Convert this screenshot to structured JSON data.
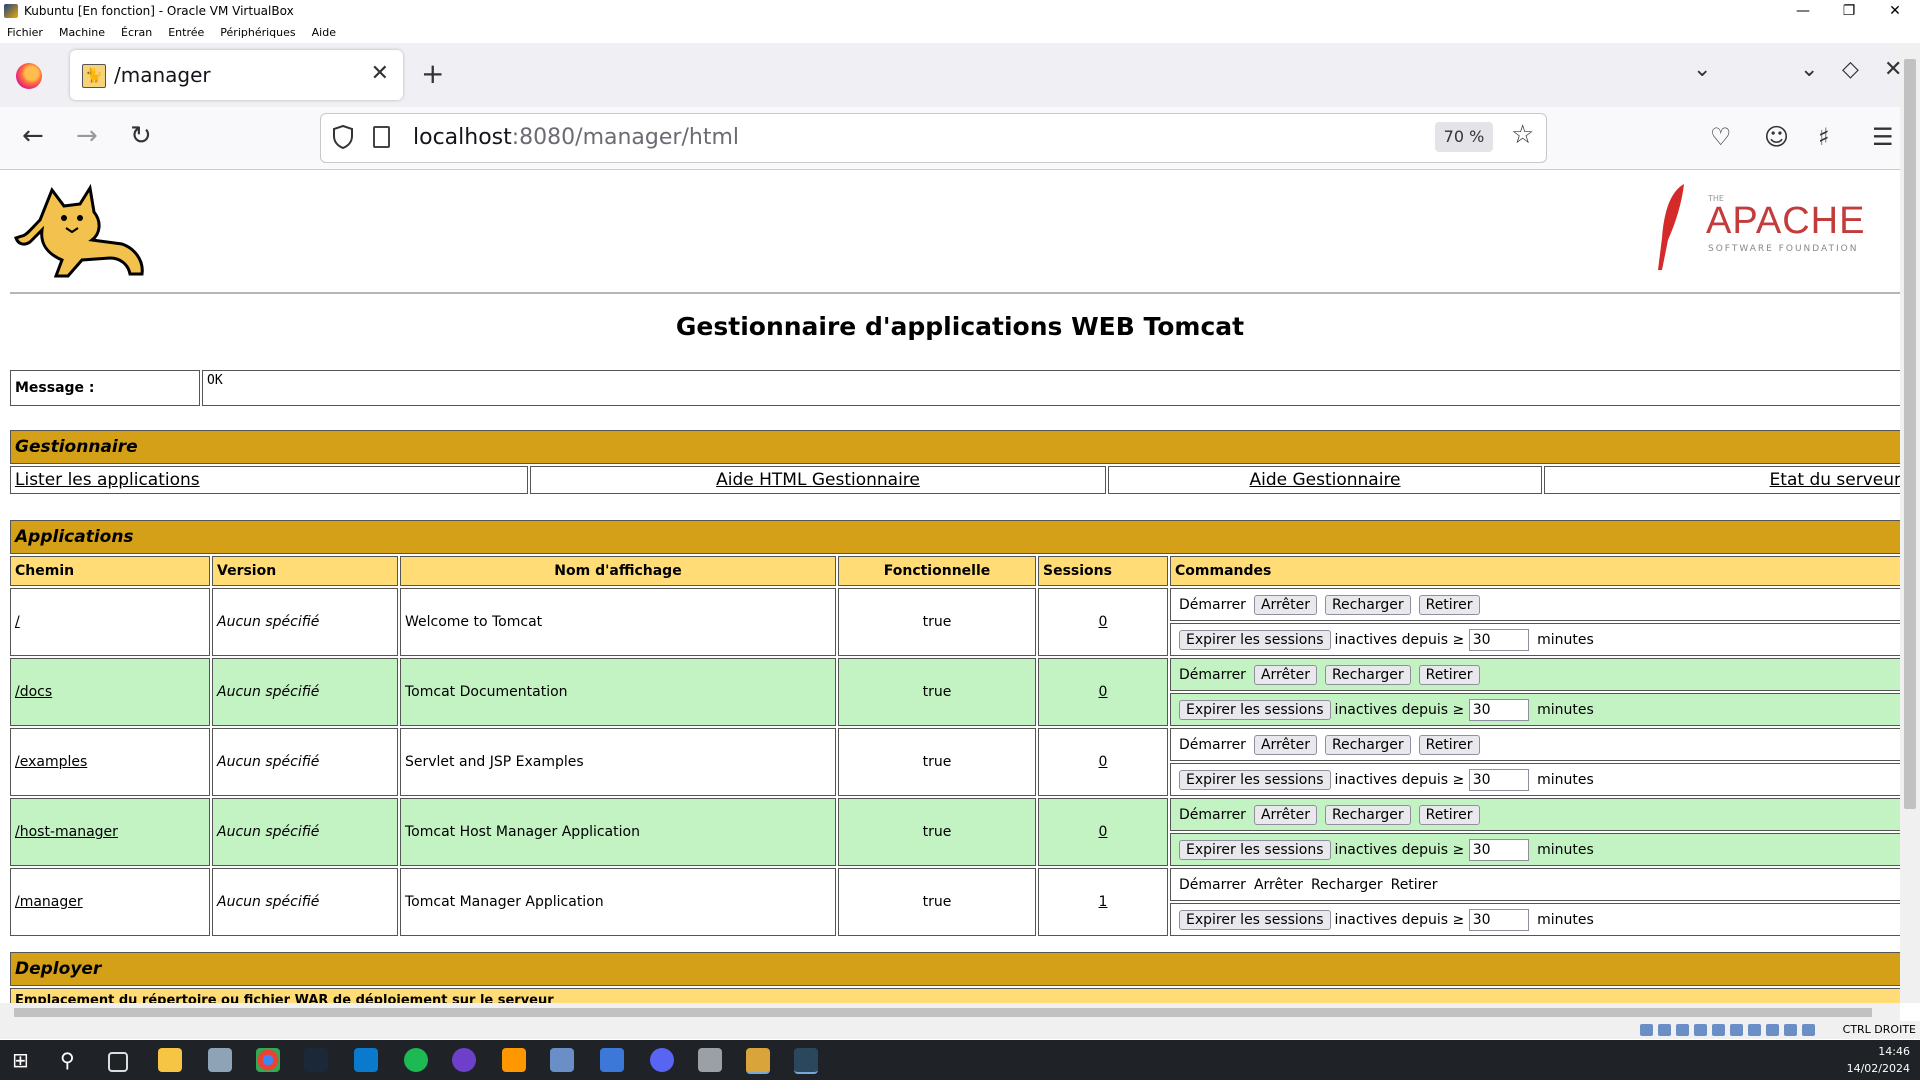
{
  "vbox": {
    "title": "Kubuntu [En fonction] - Oracle VM VirtualBox",
    "menu": [
      "Fichier",
      "Machine",
      "Écran",
      "Entrée",
      "Périphériques",
      "Aide"
    ],
    "status_right": "CTRL DROITE"
  },
  "browser": {
    "tab_title": "/manager",
    "url_host": "localhost",
    "url_rest": ":8080/manager/html",
    "zoom": "70 %"
  },
  "page": {
    "apache_small": "THE",
    "apache_name": "APACHE",
    "apache_sub": "SOFTWARE FOUNDATION",
    "title": "Gestionnaire d'applications WEB Tomcat",
    "message_label": "Message :",
    "message_value": "OK",
    "manager_section": "Gestionnaire",
    "manager_links": [
      "Lister les applications",
      "Aide HTML Gestionnaire",
      "Aide Gestionnaire",
      "Etat du serveur"
    ],
    "apps_section": "Applications",
    "columns": [
      "Chemin",
      "Version",
      "Nom d'affichage",
      "Fonctionnelle",
      "Sessions",
      "Commandes"
    ],
    "cmd": {
      "start": "Démarrer",
      "stop": "Arrêter",
      "reload": "Recharger",
      "undeploy": "Retirer",
      "expire": "Expirer les sessions",
      "inactive": "inactives depuis ≥",
      "minutes": "minutes",
      "idle_value": "30"
    },
    "apps": [
      {
        "path": "/",
        "version": "Aucun spécifié",
        "name": "Welcome to Tomcat",
        "running": "true",
        "sessions": "0"
      },
      {
        "path": "/docs",
        "version": "Aucun spécifié",
        "name": "Tomcat Documentation",
        "running": "true",
        "sessions": "0"
      },
      {
        "path": "/examples",
        "version": "Aucun spécifié",
        "name": "Servlet and JSP Examples",
        "running": "true",
        "sessions": "0"
      },
      {
        "path": "/host-manager",
        "version": "Aucun spécifié",
        "name": "Tomcat Host Manager Application",
        "running": "true",
        "sessions": "0"
      },
      {
        "path": "/manager",
        "version": "Aucun spécifié",
        "name": "Tomcat Manager Application",
        "running": "true",
        "sessions": "1"
      }
    ],
    "deploy_section": "Deployer",
    "deploy_sub": "Emplacement du répertoire ou fichier WAR de déploiement sur le serveur"
  },
  "taskbar": {
    "time": "14:46",
    "date": "14/02/2024"
  }
}
